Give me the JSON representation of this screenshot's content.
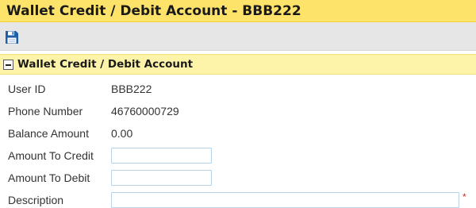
{
  "window": {
    "title": "Wallet Credit / Debit Account - BBB222"
  },
  "toolbar": {
    "save_icon": "floppy-disk-icon"
  },
  "section": {
    "title": "Wallet Credit / Debit Account",
    "collapse_icon": "minus-box-icon"
  },
  "fields": {
    "user_id": {
      "label": "User ID",
      "value": "BBB222"
    },
    "phone_number": {
      "label": "Phone Number",
      "value": "46760000729"
    },
    "balance_amount": {
      "label": "Balance Amount",
      "value": "0.00"
    },
    "amount_to_credit": {
      "label": "Amount To Credit",
      "value": ""
    },
    "amount_to_debit": {
      "label": "Amount To Debit",
      "value": ""
    },
    "description": {
      "label": "Description",
      "value": "",
      "required_marker": "*"
    }
  },
  "colors": {
    "title_bar": "#fde36a",
    "section_header": "#fdf3a9",
    "toolbar": "#e6e6e6",
    "save_icon": "#1f5fa8",
    "required": "#d9272e",
    "input_border": "#b9d3ec"
  }
}
